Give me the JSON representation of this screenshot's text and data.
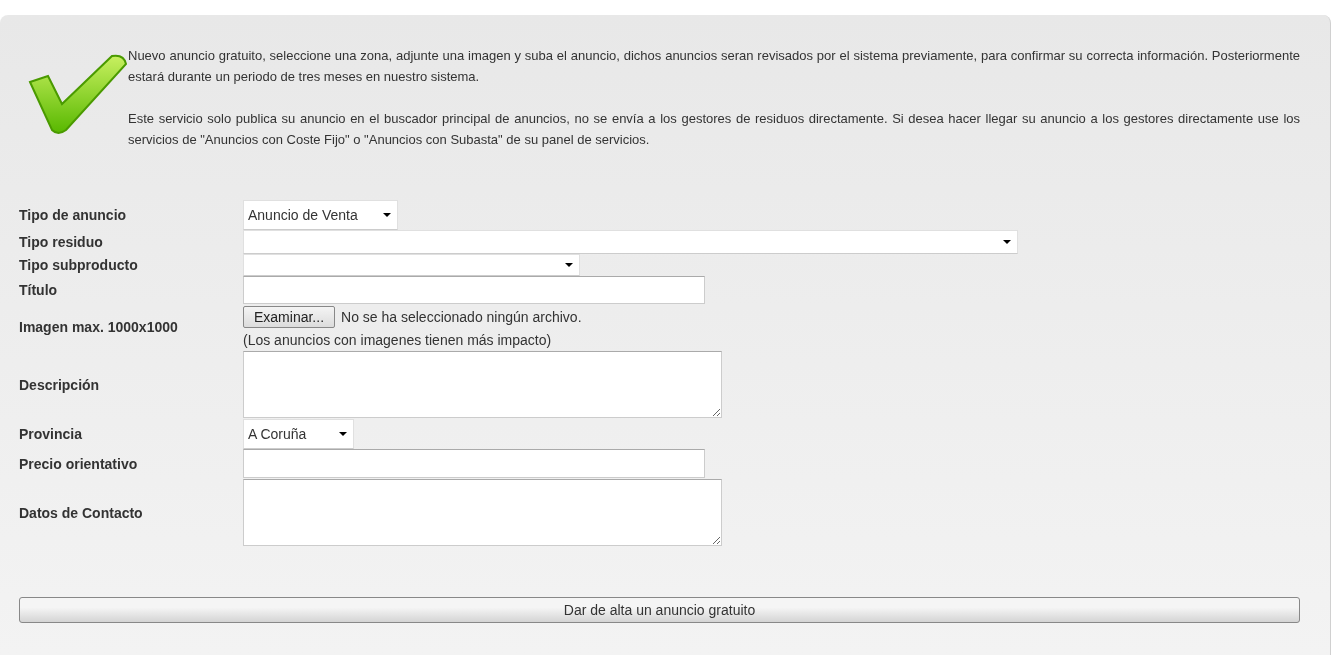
{
  "intro": {
    "paragraphs": [
      "Nuevo anuncio gratuito, seleccione una zona, adjunte una imagen y suba el anuncio, dichos anuncios seran revisados por el sistema previamente, para confirmar su correcta información. Posteriormente estará durante un periodo de tres meses en nuestro sistema.",
      "Este servicio solo publica su anuncio en el buscador principal de anuncios, no se envía a los gestores de residuos directamente. Si desea hacer llegar su anuncio a los gestores directamente use los servicios de \"Anuncios con Coste Fijo\" o \"Anuncios con Subasta\" de su panel de servicios."
    ]
  },
  "form": {
    "fields": [
      {
        "label": "Tipo de anuncio",
        "kind": "select",
        "value": "Anuncio de Venta"
      },
      {
        "label": "Tipo residuo",
        "kind": "select"
      },
      {
        "label": "Tipo subproducto",
        "kind": "select"
      },
      {
        "label": "Título",
        "kind": "text"
      },
      {
        "label": "Imagen max. 1000x1000",
        "kind": "file",
        "button": "Examinar...",
        "status": "No se ha seleccionado ningún archivo.",
        "hint": "(Los anuncios con imagenes tienen más impacto)"
      },
      {
        "label": "Descripción",
        "kind": "textarea"
      },
      {
        "label": "Provincia",
        "kind": "select",
        "value": "A Coruña"
      },
      {
        "label": "Precio orientativo",
        "kind": "text"
      },
      {
        "label": "Datos de Contacto",
        "kind": "textarea"
      }
    ]
  },
  "submit": {
    "label": "Dar de alta un anuncio gratuito"
  }
}
